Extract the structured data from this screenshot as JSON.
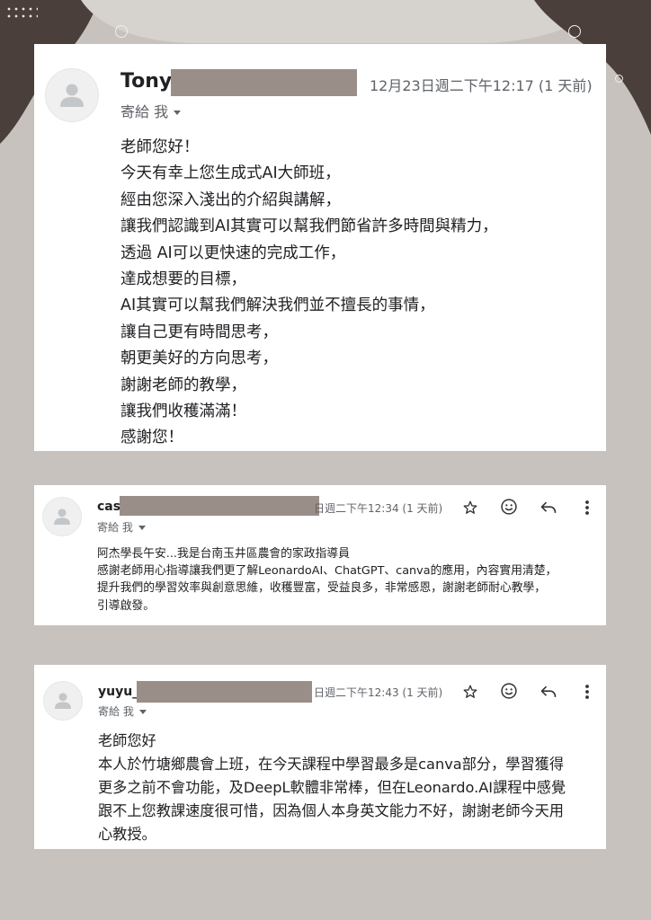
{
  "email1": {
    "sender": "Tony",
    "time": "12月23日週二下午12:17 (1 天前)",
    "to": "寄給 我",
    "body": [
      "老師您好！",
      "今天有幸上您生成式AI大師班，",
      "經由您深入淺出的介紹與講解，",
      "讓我們認識到AI其實可以幫我們節省許多時間與精力，",
      "透過 AI可以更快速的完成工作，",
      "達成想要的目標，",
      "AI其實可以幫我們解決我們並不擅長的事情，",
      "讓自己更有時間思考，",
      "朝更美好的方向思考，",
      "謝謝老師的教學，",
      "讓我們收穫滿滿！",
      "感謝您！"
    ]
  },
  "email2": {
    "sender": "cas",
    "time": "日週二下午12:34 (1 天前)",
    "to": "寄給 我",
    "body": [
      "阿杰學長午安...我是台南玉井區農會的家政指導員",
      "感謝老師用心指導讓我們更了解LeonardoAI、ChatGPT、canva的應用，內容實用清楚，",
      "提升我們的學習效率與創意思維，收穫豐富，受益良多，非常感恩，謝謝老師耐心教學，",
      "引導啟發。"
    ]
  },
  "email3": {
    "sender": "yuyu_",
    "time": "日週二下午12:43 (1 天前)",
    "to": "寄給 我",
    "body": [
      "老師您好",
      "本人於竹塘鄉農會上班，在今天課程中學習最多是canva部分，學習獲得",
      "更多之前不會功能，及DeepL軟體非常棒，但在Leonardo.AI課程中感覺",
      "跟不上您教課速度很可惜，因為個人本身英文能力不好，謝謝老師今天用",
      "心教授。"
    ]
  },
  "icons": [
    "person-icon",
    "star-icon",
    "emoji-icon",
    "reply-icon",
    "more-vert-icon",
    "chevron-down-icon"
  ],
  "colors": {
    "background": "#c7c2bd",
    "dark_blob": "#4a3f3a",
    "redaction": "#9a8e88"
  }
}
